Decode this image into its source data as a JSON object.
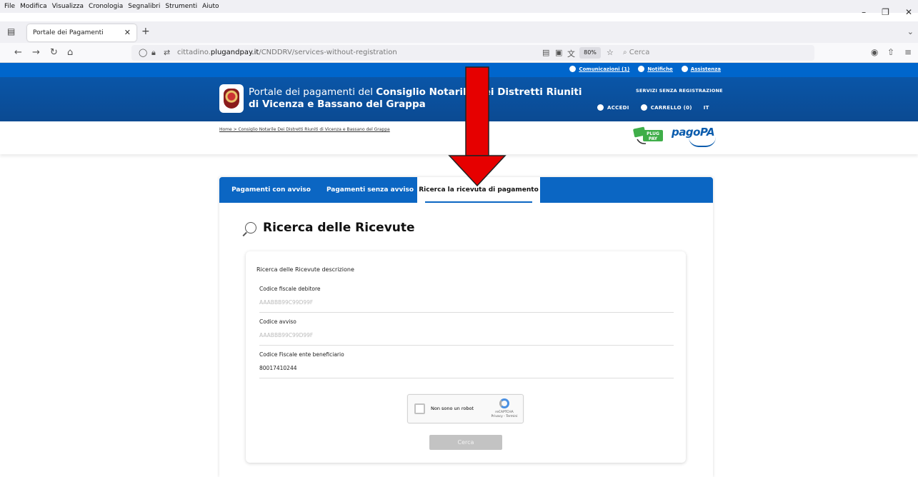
{
  "browser": {
    "menu": [
      "File",
      "Modifica",
      "Visualizza",
      "Cronologia",
      "Segnalibri",
      "Strumenti",
      "Aiuto"
    ],
    "tab_title": "Portale dei Pagamenti",
    "url_prefix": "cittadino.",
    "url_domain": "plugandpay.it",
    "url_path": "/CNDDRV/services-without-registration",
    "zoom": "80%",
    "search_placeholder": "Cerca"
  },
  "site": {
    "util_links": [
      "Comunicazioni (1)",
      "Notifiche",
      "Assistenza"
    ],
    "title_prefix": "Portale dei pagamenti del ",
    "title_strong": "Consiglio Notarile Dei Distretti Riuniti di Vicenza e Bassano del Grappa",
    "senza_registrazione": "SERVIZI SENZA REGISTRAZIONE",
    "accedi": "ACCEDI",
    "carrello": "CARRELLO (0)",
    "lang": "IT",
    "breadcrumb": "Home > Consiglio Notarile Dei Distretti Riuniti di Vicenza e Bassano del Grappa",
    "pagopa": "pagoPA",
    "plugpay_text": "PLUG PAY"
  },
  "tabs": [
    "Pagamenti con avviso",
    "Pagamenti senza avviso",
    "Ricerca la ricevuta di pagamento"
  ],
  "page": {
    "title": "Ricerca delle Ricevute",
    "description": "Ricerca delle Ricevute descrizione"
  },
  "form": {
    "fields": [
      {
        "label": "Codice fiscale debitore",
        "placeholder": "AAABBB99C99D99F",
        "value": ""
      },
      {
        "label": "Codice avviso",
        "placeholder": "AAABBB99C99D99F",
        "value": ""
      },
      {
        "label": "Codice Fiscale ente beneficiario",
        "placeholder": "",
        "value": "80017410244"
      }
    ],
    "captcha_label": "Non sono un robot",
    "captcha_brand": "reCAPTCHA",
    "captcha_links": "Privacy - Termini",
    "submit": "Cerca"
  },
  "colors": {
    "primary_blue": "#0b66c3",
    "arrow_red": "#e60000"
  }
}
